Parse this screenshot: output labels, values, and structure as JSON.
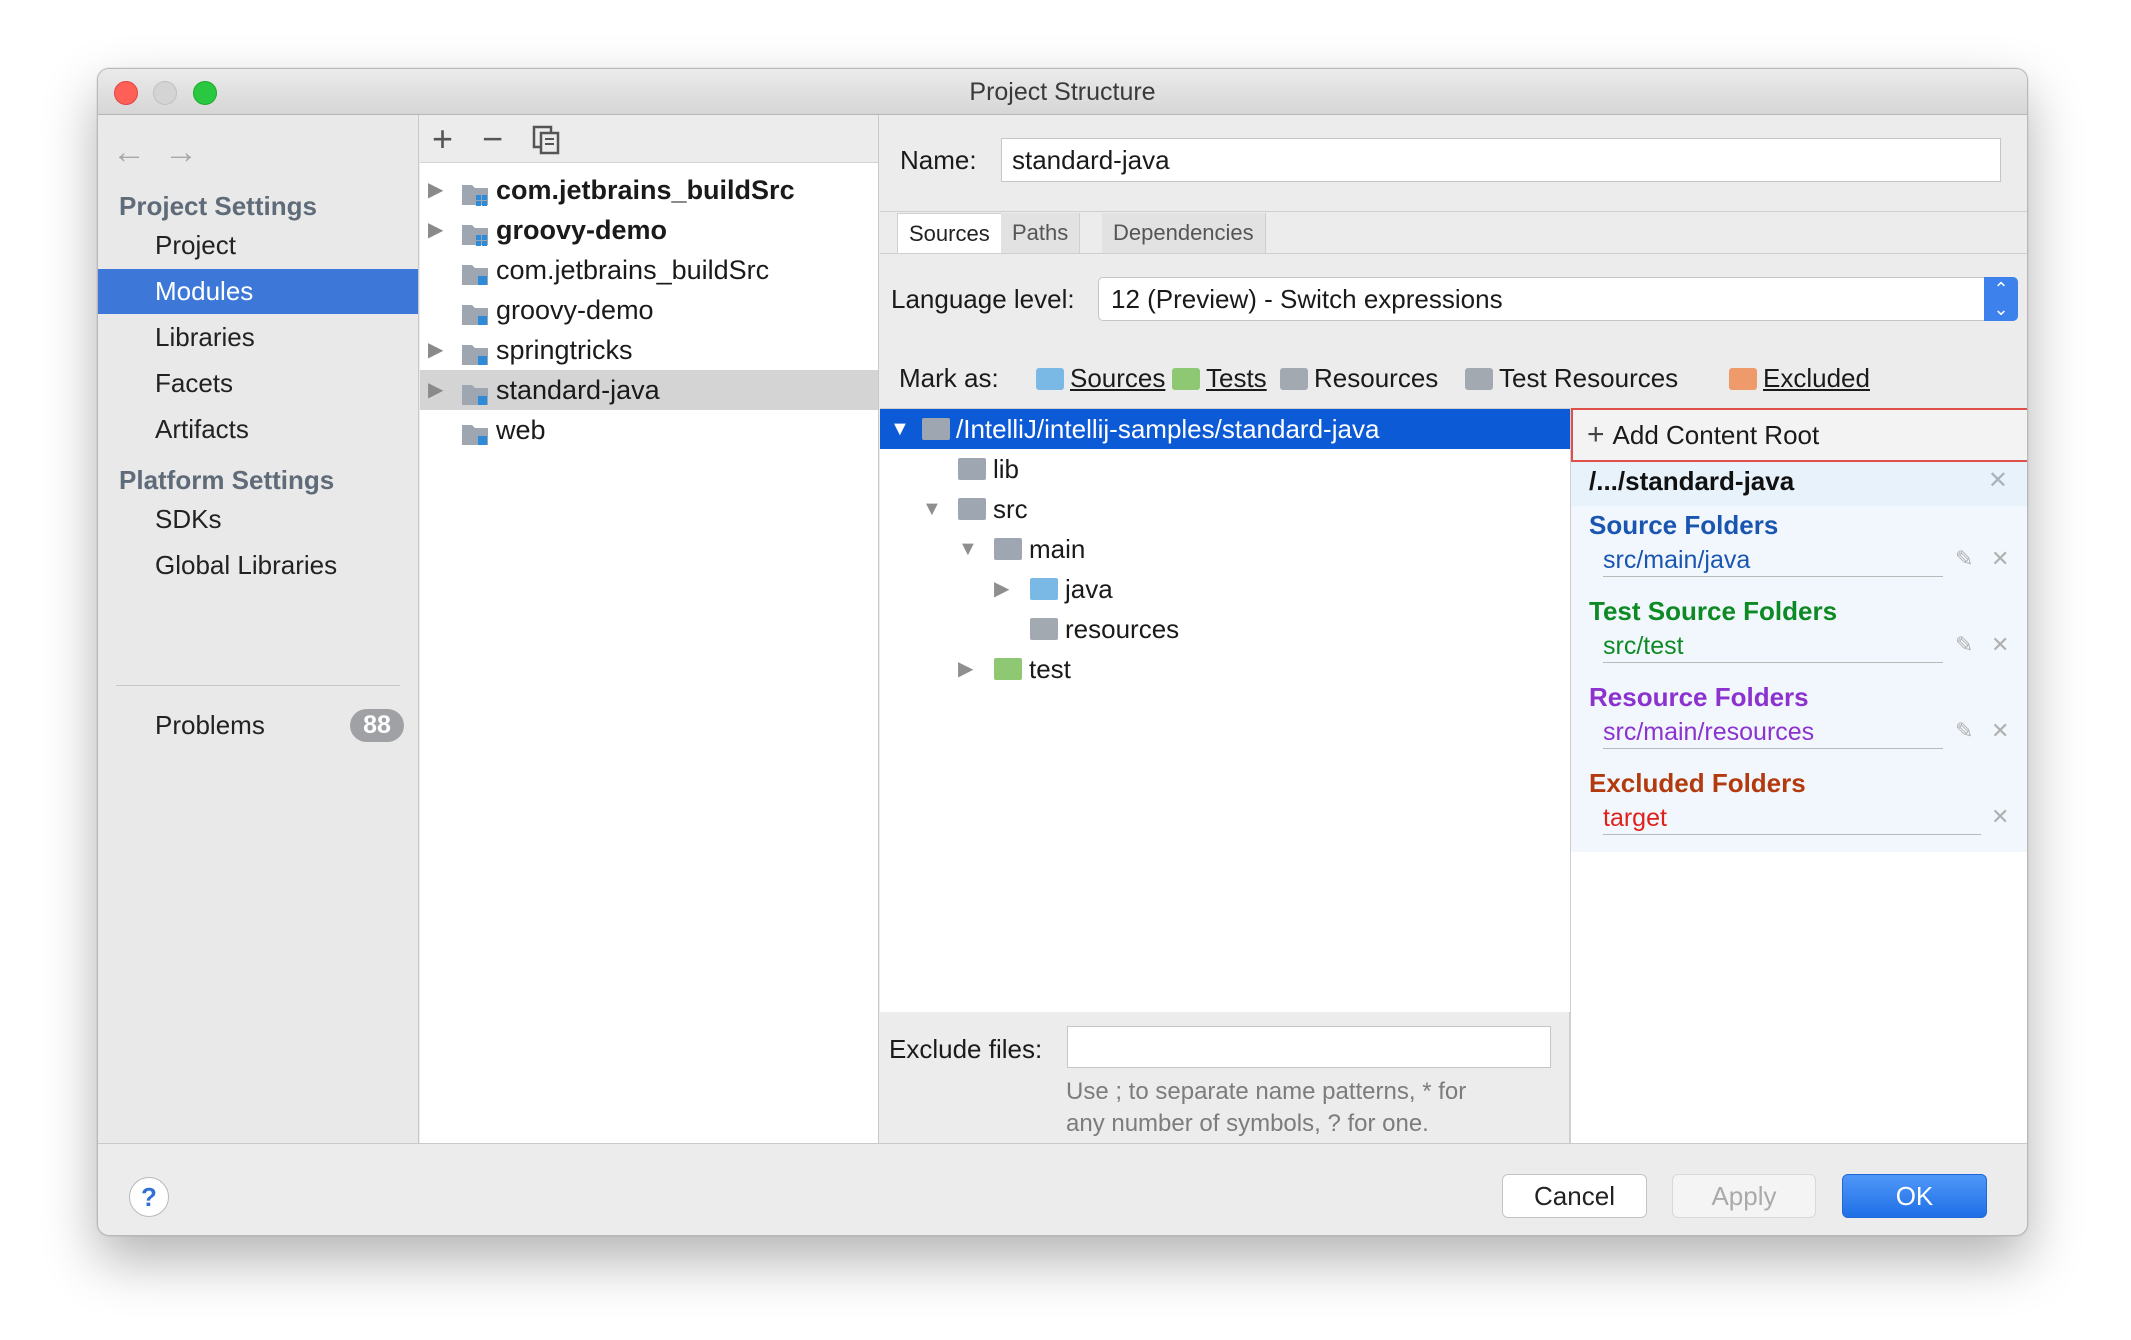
{
  "window": {
    "title": "Project Structure"
  },
  "nav": {
    "back_icon": "arrow-left-icon",
    "forward_icon": "arrow-right-icon",
    "project_settings_heading": "Project Settings",
    "project_items": [
      "Project",
      "Modules",
      "Libraries",
      "Facets",
      "Artifacts"
    ],
    "platform_settings_heading": "Platform Settings",
    "platform_items": [
      "SDKs",
      "Global Libraries"
    ],
    "problems_label": "Problems",
    "problems_count": "88",
    "selected": "Modules"
  },
  "modules_toolbar": {
    "add": "+",
    "remove": "−",
    "copy_icon": "copy-icon"
  },
  "modules": [
    {
      "label": "com.jetbrains_buildSrc",
      "bold": true,
      "expandable": true
    },
    {
      "label": "groovy-demo",
      "bold": true,
      "expandable": true
    },
    {
      "label": "com.jetbrains_buildSrc",
      "bold": false,
      "expandable": false
    },
    {
      "label": "groovy-demo",
      "bold": false,
      "expandable": false
    },
    {
      "label": "springtricks",
      "bold": false,
      "expandable": true
    },
    {
      "label": "standard-java",
      "bold": false,
      "expandable": true,
      "selected": true
    },
    {
      "label": "web",
      "bold": false,
      "expandable": false
    }
  ],
  "detail": {
    "name_label": "Name:",
    "name_value": "standard-java",
    "tabs": [
      "Sources",
      "Paths",
      "Dependencies"
    ],
    "active_tab": "Sources",
    "language_label": "Language level:",
    "language_value": "12 (Preview) - Switch expressions",
    "mark_as_label": "Mark as:",
    "mark_as": [
      {
        "label": "Sources",
        "color": "#7ab8e6"
      },
      {
        "label": "Tests",
        "color": "#8fc873"
      },
      {
        "label": "Resources",
        "color": "#a3a9b0"
      },
      {
        "label": "Test Resources",
        "color": "#a3a9b0"
      },
      {
        "label": "Excluded",
        "color": "#ee9a6a"
      }
    ],
    "tree": [
      {
        "label": "/IntelliJ/intellij-samples/standard-java",
        "expanded": true,
        "selected": true
      },
      {
        "label": "lib"
      },
      {
        "label": "src",
        "expanded": true
      },
      {
        "label": "main",
        "expanded": true
      },
      {
        "label": "java",
        "collapsed": true
      },
      {
        "label": "resources"
      },
      {
        "label": "test",
        "collapsed": true
      }
    ],
    "exclude_label": "Exclude files:",
    "exclude_value": "",
    "exclude_hint_1": "Use ; to separate name patterns, * for",
    "exclude_hint_2": "any number of symbols, ? for one."
  },
  "content_root": {
    "add_label": "Add Content Root",
    "root_path": "/.../standard-java",
    "source_folders_heading": "Source Folders",
    "source_folder": "src/main/java",
    "test_folders_heading": "Test Source Folders",
    "test_folder": "src/test",
    "resource_folders_heading": "Resource Folders",
    "resource_folder": "src/main/resources",
    "excluded_folders_heading": "Excluded Folders",
    "excluded_folder": "target",
    "colors": {
      "source": "#1a56b0",
      "test": "#0e8a24",
      "resource": "#8b32cf",
      "excluded_head": "#b23a0c",
      "excluded_path": "#e0201a"
    }
  },
  "footer": {
    "help": "?",
    "cancel": "Cancel",
    "apply": "Apply",
    "ok": "OK"
  }
}
